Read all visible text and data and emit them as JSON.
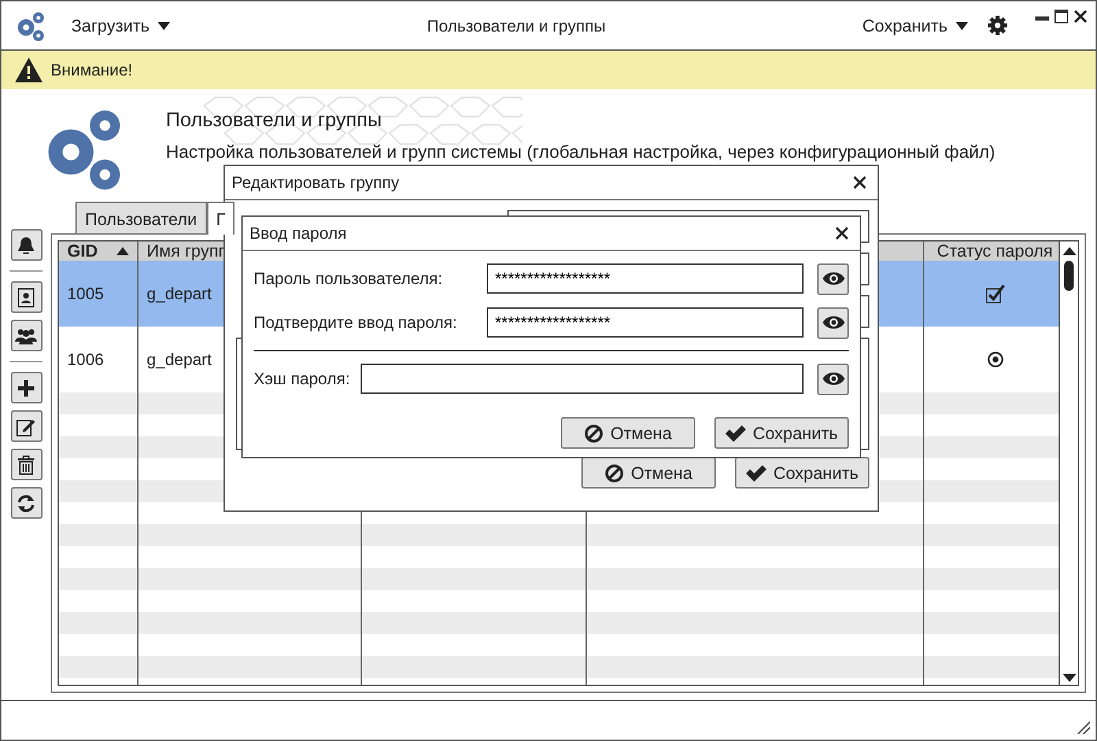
{
  "app_bar": {
    "load_menu": "Загрузить",
    "title": "Пользователи и группы",
    "save_menu": "Сохранить"
  },
  "warning": {
    "text": "Внимание!"
  },
  "header": {
    "title": "Пользователи и группы",
    "description": "Настройка пользователей и групп системы (глобальная настройка, через конфигурационный файл)"
  },
  "tabs": [
    {
      "label": "Пользователи",
      "selected": false
    },
    {
      "label": "Г",
      "selected": true
    }
  ],
  "table": {
    "columns": [
      {
        "label": "GID",
        "sorted": true
      },
      {
        "label": "Имя групп",
        "sorted": false
      },
      {
        "label": "Статус пароля",
        "sorted": false
      }
    ],
    "rows": [
      {
        "gid": "1005",
        "name": "g_depart",
        "kind": "checkbox",
        "selected": true
      },
      {
        "gid": "1006",
        "name": "g_depart",
        "kind": "radio",
        "selected": false
      }
    ]
  },
  "edit_dialog": {
    "title": "Редактировать группу",
    "cancel": "Отмена",
    "save": "Сохранить"
  },
  "password_dialog": {
    "title": "Ввод пароля",
    "fields": [
      {
        "label": "Пароль пользователеля:",
        "value": "******************"
      },
      {
        "label": "Подтвердите ввод пароля:",
        "value": "******************"
      }
    ],
    "hash": {
      "label": "Хэш пароля:"
    },
    "cancel": "Отмена",
    "save": "Сохранить"
  }
}
